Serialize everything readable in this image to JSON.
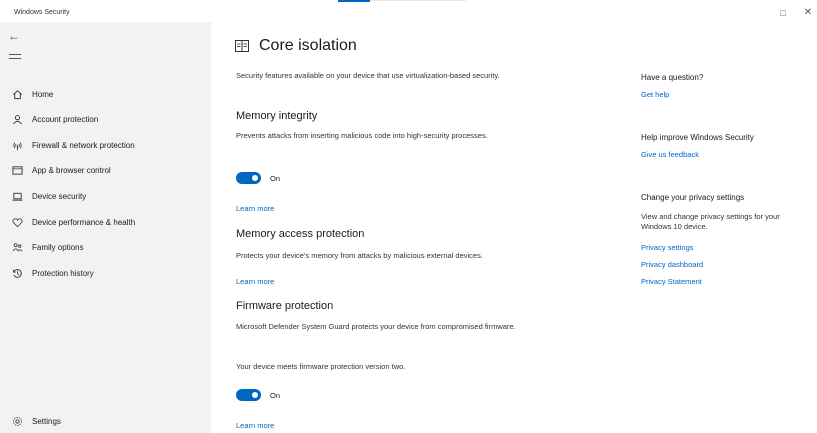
{
  "window": {
    "title": "Windows Security",
    "restore_glyph": "□",
    "close_glyph": "✕"
  },
  "sidebar": {
    "back_glyph": "←",
    "items": [
      {
        "label": "Home",
        "icon": "home-icon"
      },
      {
        "label": "Account protection",
        "icon": "person-icon"
      },
      {
        "label": "Firewall & network protection",
        "icon": "wireless-icon"
      },
      {
        "label": "App & browser control",
        "icon": "browser-window-icon"
      },
      {
        "label": "Device security",
        "icon": "laptop-icon"
      },
      {
        "label": "Device performance & health",
        "icon": "heart-icon"
      },
      {
        "label": "Family options",
        "icon": "family-icon"
      },
      {
        "label": "Protection history",
        "icon": "history-icon"
      }
    ],
    "settings_label": "Settings"
  },
  "main": {
    "title": "Core isolation",
    "intro": "Security features available on your device that use virtualization-based security.",
    "memory_integrity": {
      "heading": "Memory integrity",
      "description": "Prevents attacks from inserting malicious code into high-security processes.",
      "toggle_state": "On",
      "learn_more": "Learn more"
    },
    "memory_access": {
      "heading": "Memory access protection",
      "description": "Protects your device's memory from attacks by malicious external devices.",
      "learn_more": "Learn more"
    },
    "firmware": {
      "heading": "Firmware protection",
      "description": "Microsoft Defender System Guard protects your device from compromised firmware.",
      "status": "Your device meets firmware protection version two.",
      "toggle_state": "On",
      "learn_more": "Learn more"
    }
  },
  "right_panel": {
    "question_heading": "Have a question?",
    "get_help": "Get help",
    "improve_heading": "Help improve Windows Security",
    "feedback": "Give us feedback",
    "privacy_heading": "Change your privacy settings",
    "privacy_text": "View and change privacy settings for your Windows 10 device.",
    "privacy_settings": "Privacy settings",
    "privacy_dashboard": "Privacy dashboard",
    "privacy_statement": "Privacy Statement"
  },
  "colors": {
    "accent": "#0067c0",
    "sidebar_bg": "#f2f2f2"
  }
}
